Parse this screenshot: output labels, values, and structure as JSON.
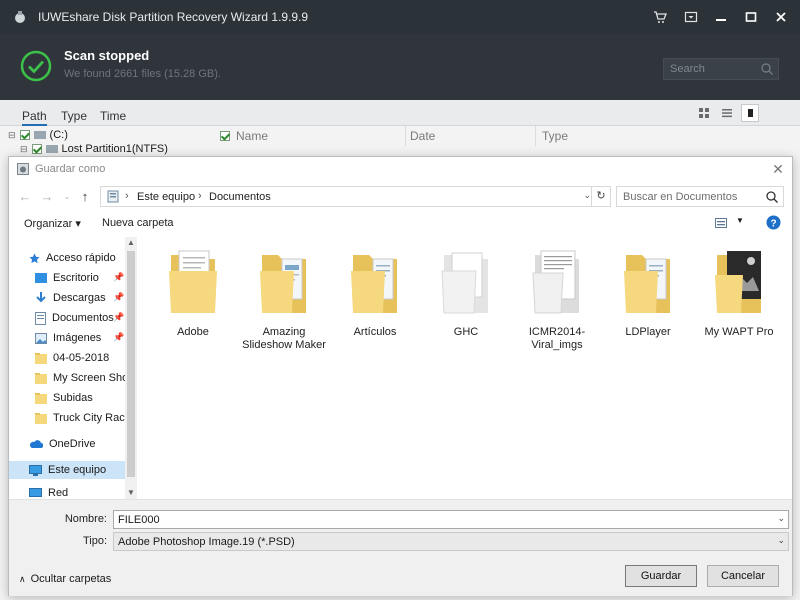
{
  "app": {
    "title": "IUWEshare Disk Partition Recovery Wizard 1.9.9.9",
    "status_title": "Scan stopped",
    "status_sub": "We found 2661 files (15.28 GB).",
    "search_placeholder": "Search",
    "tabs": [
      "Path",
      "Type",
      "Time"
    ],
    "tree": [
      {
        "label": "(C:)"
      },
      {
        "label": "Lost Partition1(NTFS)"
      }
    ],
    "columns": [
      "Name",
      "Date",
      "Type"
    ],
    "colors": {
      "titlebar": "#2b3238",
      "status": "#2f353a",
      "check": "#3cc24a"
    }
  },
  "dialog": {
    "title": "Guardar como",
    "breadcrumb": [
      "Este equipo",
      "Documentos"
    ],
    "search_placeholder": "Buscar en Documentos",
    "organize_label": "Organizar ▾",
    "new_folder_label": "Nueva carpeta",
    "nav": [
      {
        "label": "Acceso rápido",
        "icon": "star-icon"
      },
      {
        "label": "Escritorio",
        "icon": "desktop-icon",
        "pinned": true
      },
      {
        "label": "Descargas",
        "icon": "download-icon",
        "pinned": true
      },
      {
        "label": "Documentos",
        "icon": "document-icon",
        "pinned": true
      },
      {
        "label": "Imágenes",
        "icon": "pictures-icon",
        "pinned": true
      },
      {
        "label": "04-05-2018",
        "icon": "folder-icon"
      },
      {
        "label": "My Screen Shots",
        "icon": "folder-icon"
      },
      {
        "label": "Subidas",
        "icon": "folder-icon"
      },
      {
        "label": "Truck City Racin",
        "icon": "folder-icon"
      },
      {
        "label": "OneDrive",
        "icon": "cloud-icon"
      },
      {
        "label": "Este equipo",
        "icon": "computer-icon",
        "selected": true
      },
      {
        "label": "Red",
        "icon": "network-icon"
      }
    ],
    "files": [
      {
        "name": "Adobe",
        "kind": "docs"
      },
      {
        "name": "Amazing Slideshow Maker",
        "kind": "docs"
      },
      {
        "name": "Artículos",
        "kind": "docs"
      },
      {
        "name": "GHC",
        "kind": "plain"
      },
      {
        "name": "ICMR2014-Viral_imgs",
        "kind": "docs"
      },
      {
        "name": "LDPlayer",
        "kind": "docs"
      },
      {
        "name": "My WAPT Pro",
        "kind": "image"
      }
    ],
    "filename_label": "Nombre:",
    "filename_value": "FILE000",
    "type_label": "Tipo:",
    "type_value": "Adobe Photoshop Image.19 (*.PSD)",
    "hide_folders_label": "Ocultar carpetas",
    "save_label": "Guardar",
    "cancel_label": "Cancelar"
  }
}
